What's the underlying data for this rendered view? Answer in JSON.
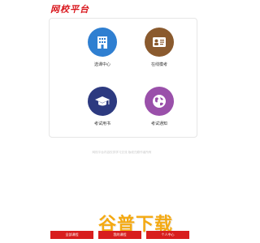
{
  "header": {
    "logo_text": "网校平台"
  },
  "tiles": [
    {
      "label": "选课中心",
      "color": "#2f7fd1",
      "icon": "building-icon"
    },
    {
      "label": "在线模考",
      "color": "#8a5a2e",
      "icon": "id-card-icon"
    },
    {
      "label": "考试用书",
      "color": "#2d3a80",
      "icon": "graduation-cap-icon"
    },
    {
      "label": "考试通知",
      "color": "#9a50aa",
      "icon": "globe-icon"
    }
  ],
  "footer": {
    "note": "网校平台内容仅供学习交流 版权归原作者所有"
  },
  "watermark": {
    "text": "谷普下载"
  },
  "bottom_buttons": [
    {
      "label": "全部课程"
    },
    {
      "label": "我的课程"
    },
    {
      "label": "个人中心"
    }
  ],
  "colors": {
    "accent": "#d81e1e",
    "watermark": "#f5a400"
  }
}
